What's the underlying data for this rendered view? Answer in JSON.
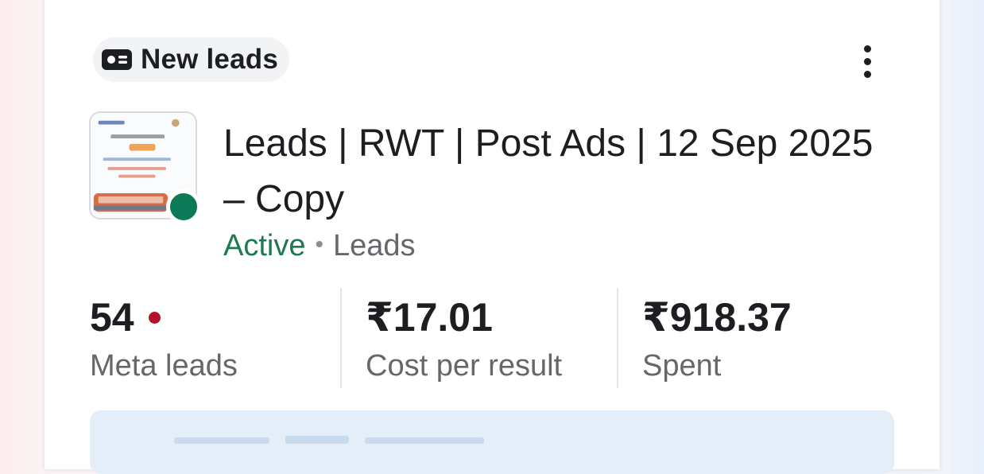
{
  "badge": {
    "label": "New leads",
    "icon": "lead-form-icon"
  },
  "menu": {
    "icon": "more-vertical-icon"
  },
  "campaign": {
    "title": "Leads | RWT | Post Ads | 12 Sep 2025 – Copy",
    "status": "Active",
    "separator": "•",
    "objective": "Leads",
    "status_color": "#0d7a57"
  },
  "metrics": [
    {
      "value": "54",
      "label": "Meta leads",
      "indicator_color": "#b3122b"
    },
    {
      "value": "₹17.01",
      "label": "Cost per result"
    },
    {
      "value": "₹918.37",
      "label": "Spent"
    }
  ],
  "colors": {
    "accent_panel": "#e3eef9",
    "text_primary": "#1c1e21",
    "text_secondary": "#65676b"
  }
}
